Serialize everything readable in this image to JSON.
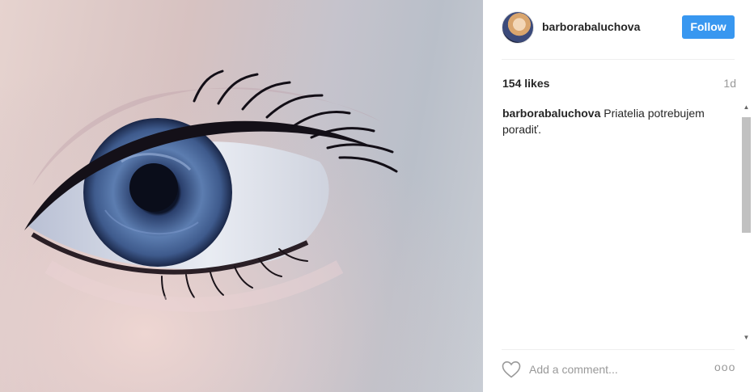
{
  "post": {
    "username": "barborabaluchova",
    "follow_label": "Follow",
    "likes_text": "154 likes",
    "time_ago": "1d",
    "caption_user": "barborabaluchova",
    "caption_text": " Priatelia potrebujem poradiť.",
    "comment_placeholder": "Add a comment...",
    "more_label": "ooo"
  },
  "colors": {
    "follow_button": "#3897f0",
    "muted_text": "#999999",
    "text": "#262626"
  },
  "icons": {
    "like": "heart-outline-icon",
    "more": "more-options-icon",
    "scroll_up": "scroll-up-arrow-icon",
    "scroll_down": "scroll-down-arrow-icon"
  },
  "scroll": {
    "position_fraction": 0.0,
    "visible_fraction": 0.55
  }
}
